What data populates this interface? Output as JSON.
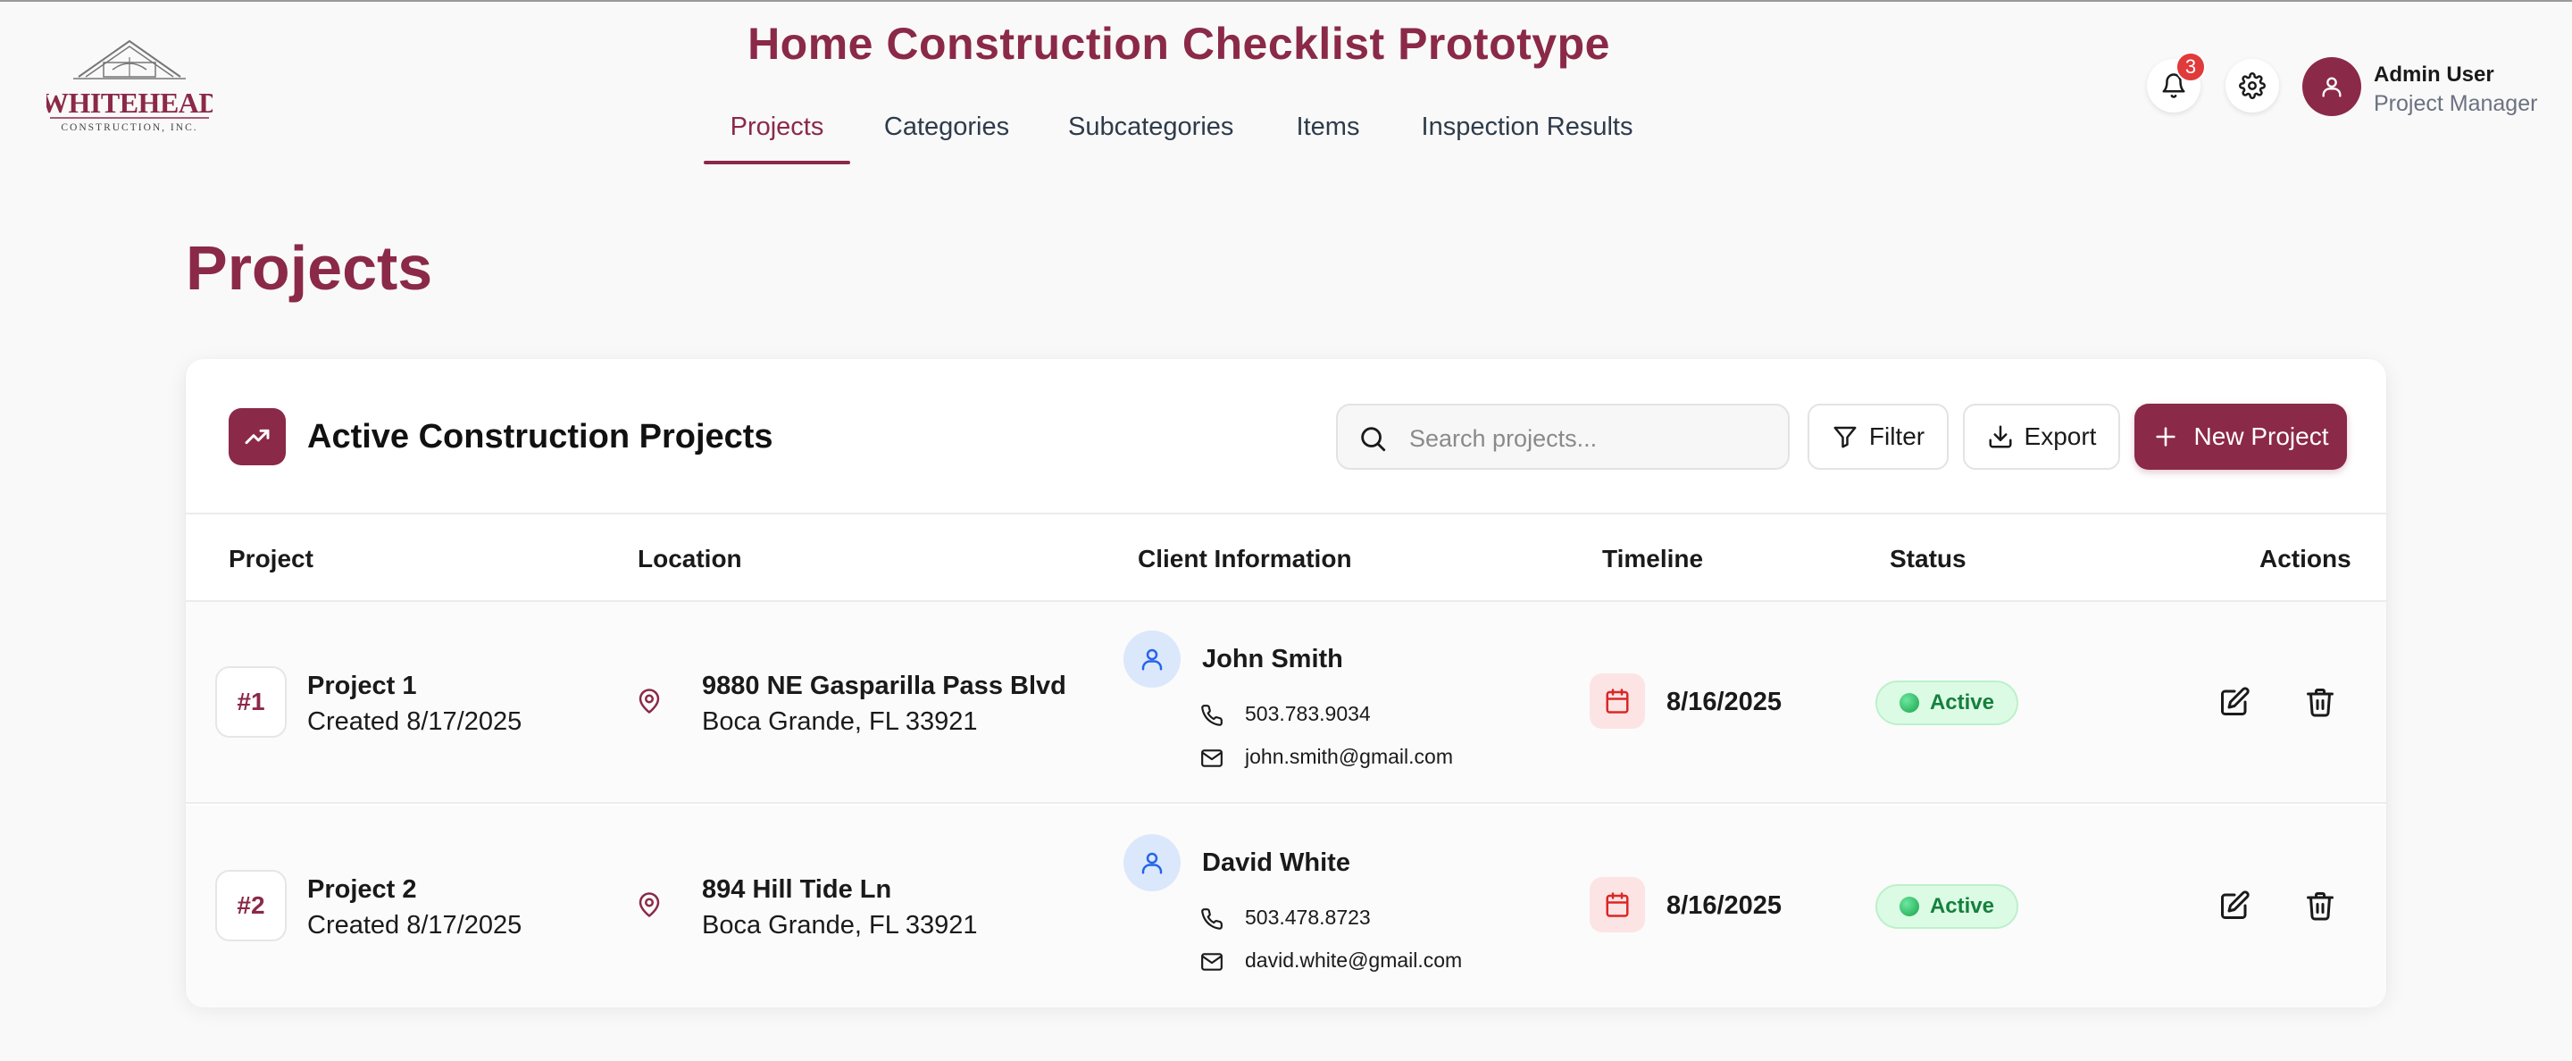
{
  "logo": {
    "name": "WHITEHEAD",
    "sub": "CONSTRUCTION, INC."
  },
  "app_title": "Home Construction Checklist Prototype",
  "nav": {
    "tabs": [
      {
        "label": "Projects",
        "active": true
      },
      {
        "label": "Categories",
        "active": false
      },
      {
        "label": "Subcategories",
        "active": false
      },
      {
        "label": "Items",
        "active": false
      },
      {
        "label": "Inspection Results",
        "active": false
      }
    ]
  },
  "header": {
    "notifications": {
      "icon": "bell-icon",
      "count": "3"
    },
    "settings": {
      "icon": "gear-icon"
    },
    "user": {
      "name": "Admin User",
      "role": "Project Manager",
      "icon": "user-icon"
    }
  },
  "page_title": "Projects",
  "card": {
    "icon": "trending-up-icon",
    "title": "Active Construction Projects",
    "search_placeholder": "Search projects...",
    "filter_label": "Filter",
    "export_label": "Export",
    "new_project_label": "New Project"
  },
  "table": {
    "headers": {
      "project": "Project",
      "location": "Location",
      "client": "Client Information",
      "timeline": "Timeline",
      "status": "Status",
      "actions": "Actions"
    },
    "rows": [
      {
        "num": "#1",
        "name": "Project 1",
        "created": "Created 8/17/2025",
        "address_line1": "9880 NE Gasparilla Pass Blvd",
        "address_line2": "Boca Grande, FL 33921",
        "client_name": "John Smith",
        "phone": "503.783.9034",
        "email": "john.smith@gmail.com",
        "date": "8/16/2025",
        "status": "Active"
      },
      {
        "num": "#2",
        "name": "Project 2",
        "created": "Created 8/17/2025",
        "address_line1": "894 Hill Tide Ln",
        "address_line2": "Boca Grande, FL 33921",
        "client_name": "David White",
        "phone": "503.478.8723",
        "email": "david.white@gmail.com",
        "date": "8/16/2025",
        "status": "Active"
      }
    ]
  },
  "colors": {
    "brand": "#8b2948",
    "status_active_bg": "#dcfbe4",
    "status_active_text": "#15803d",
    "calendar_bg": "#fde4e4",
    "client_avatar_bg": "#dbe8fb",
    "badge": "#e03a3a"
  }
}
